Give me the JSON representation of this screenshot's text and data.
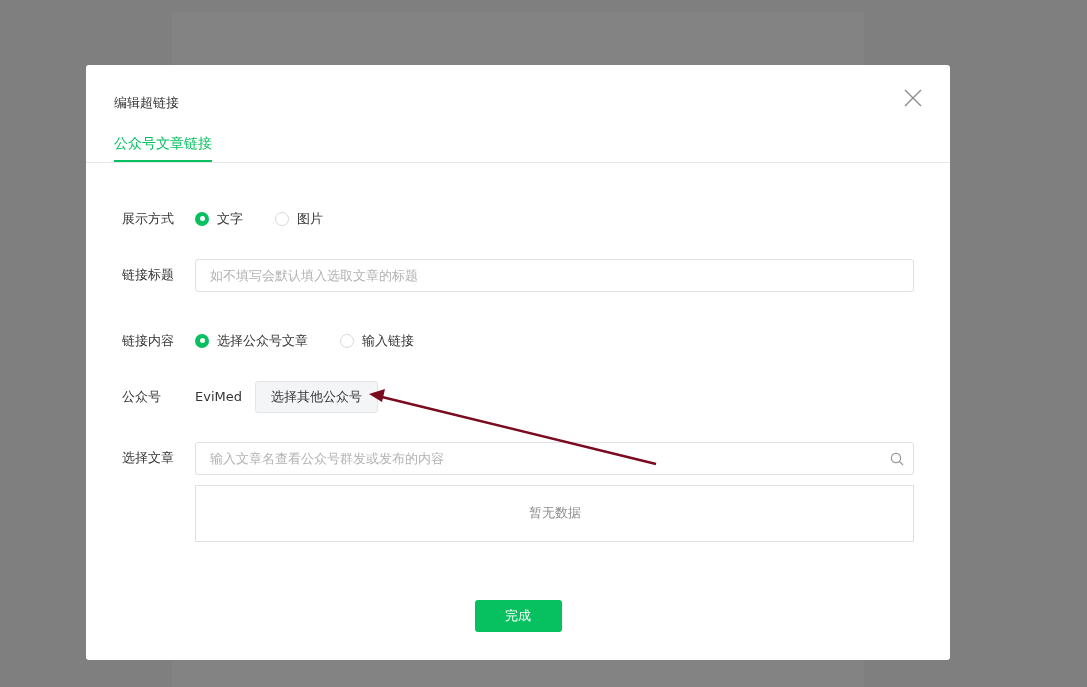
{
  "dialog": {
    "title": "编辑超链接",
    "tabs": [
      {
        "label": "公众号文章链接",
        "selected": true
      }
    ],
    "fields": [
      {
        "kind": "radio",
        "label": "展示方式",
        "options": [
          {
            "label": "文字",
            "selected": true
          },
          {
            "label": "图片",
            "selected": false
          }
        ]
      },
      {
        "kind": "text",
        "label": "链接标题",
        "placeholder": "如不填写会默认填入选取文章的标题"
      },
      {
        "kind": "radio",
        "label": "链接内容",
        "options": [
          {
            "label": "选择公众号文章",
            "selected": true
          },
          {
            "label": "输入链接",
            "selected": false
          }
        ]
      },
      {
        "kind": "account",
        "label": "公众号",
        "value": "EviMed",
        "button": "选择其他公众号"
      },
      {
        "kind": "search",
        "label": "选择文章",
        "placeholder": "输入文章名查看公众号群发或发布的内容",
        "empty_text": "暂无数据"
      }
    ],
    "confirm_button": "完成"
  }
}
